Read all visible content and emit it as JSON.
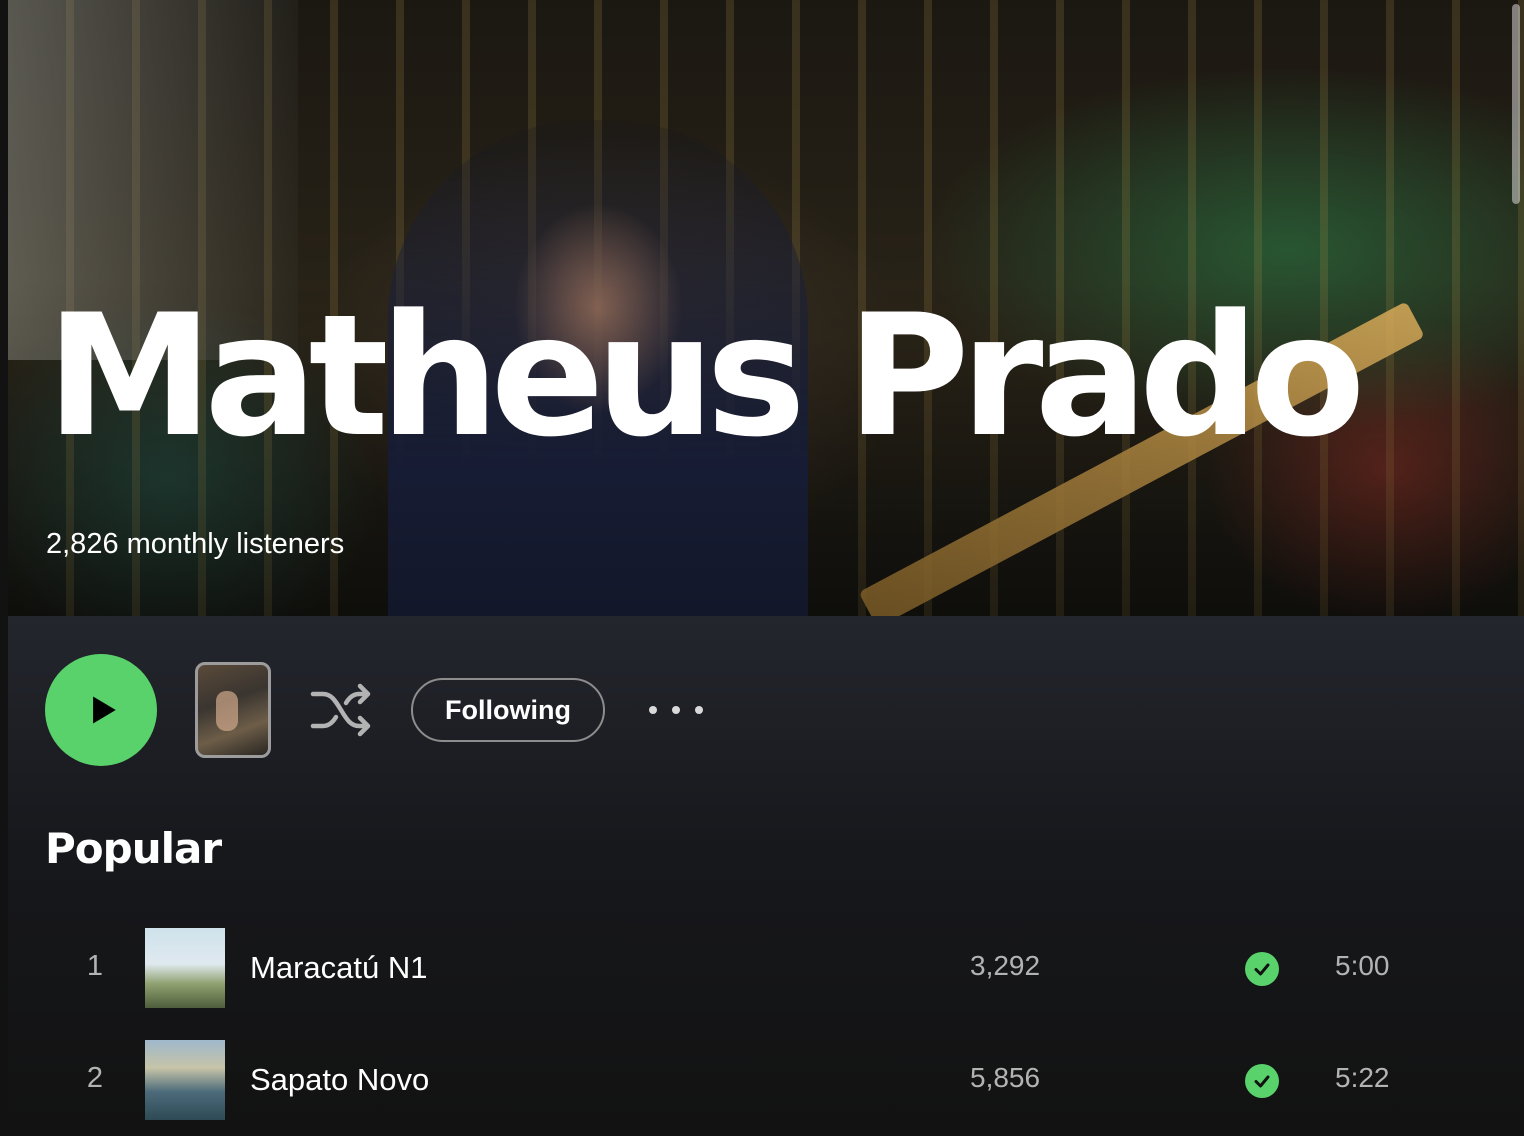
{
  "artist": {
    "name": "Matheus Prado",
    "monthly_listeners": "2,826 monthly listeners"
  },
  "actions": {
    "following_label": "Following",
    "play_icon": "play-icon",
    "shuffle_icon": "shuffle-icon",
    "more_icon": "more-options-icon"
  },
  "popular": {
    "title": "Popular",
    "tracks": [
      {
        "number": "1",
        "title": "Maracatú N1",
        "plays": "3,292",
        "duration": "5:00",
        "saved": true
      },
      {
        "number": "2",
        "title": "Sapato Novo",
        "plays": "5,856",
        "duration": "5:22",
        "saved": true
      }
    ]
  },
  "colors": {
    "accent_green": "#5ad26b",
    "background": "#121212"
  }
}
